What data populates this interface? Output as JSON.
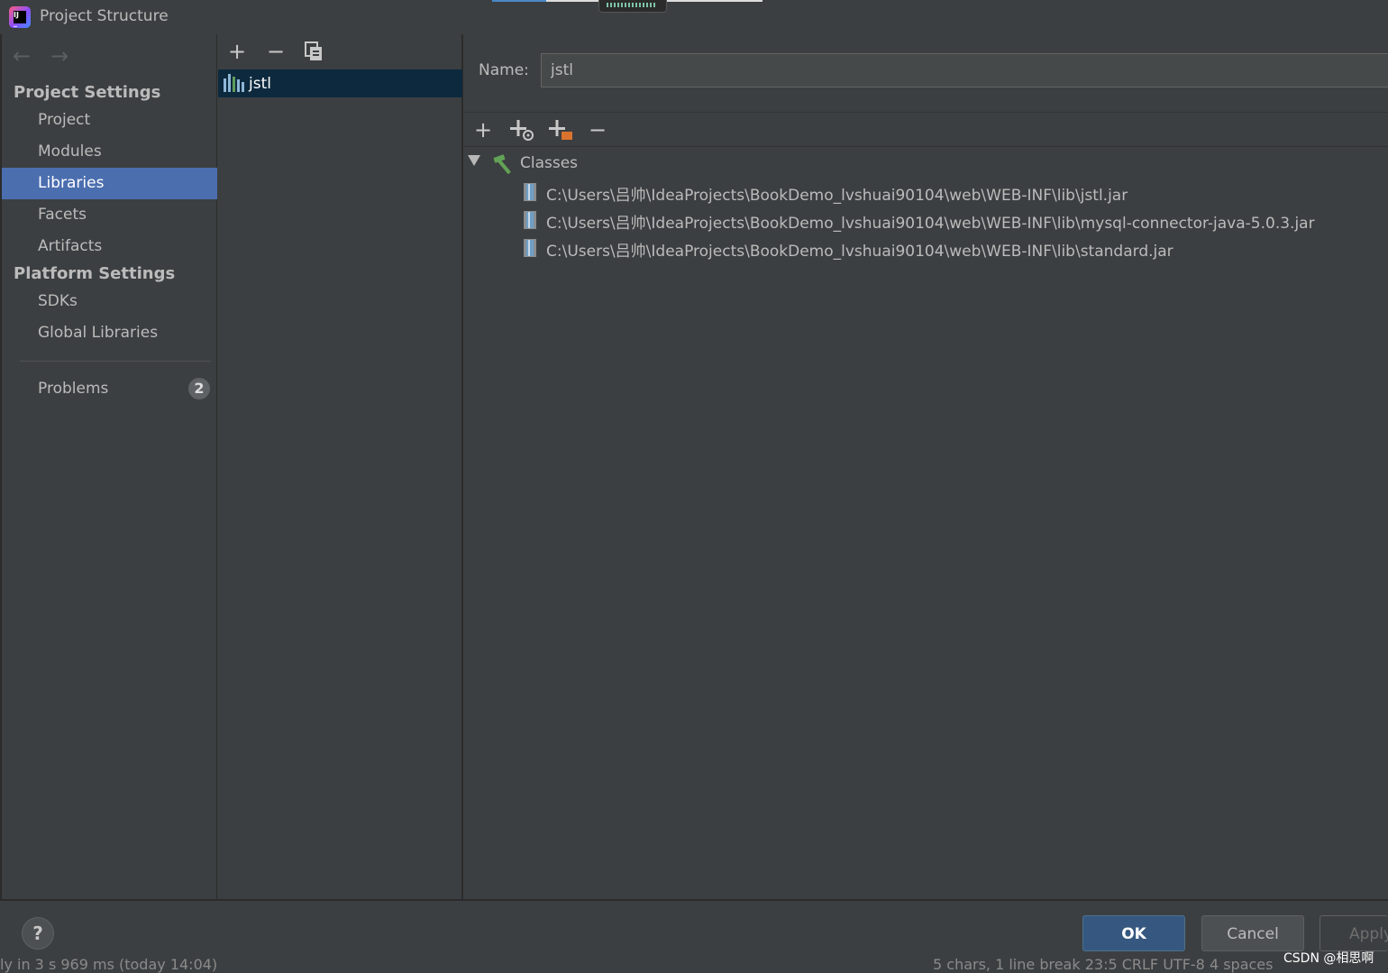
{
  "window": {
    "title": "Project Structure"
  },
  "nav": {
    "back_icon": "arrow-left-icon",
    "forward_icon": "arrow-right-icon",
    "project_settings_heading": "Project Settings",
    "project_items": [
      "Project",
      "Modules",
      "Libraries",
      "Facets",
      "Artifacts"
    ],
    "platform_settings_heading": "Platform Settings",
    "platform_items": [
      "SDKs",
      "Global Libraries"
    ],
    "problems_label": "Problems",
    "problems_count": "2",
    "selected": "Libraries"
  },
  "library_list": {
    "toolbar": {
      "add": "+",
      "remove": "−",
      "copy_icon": "copy-icon"
    },
    "items": [
      "jstl"
    ],
    "selected": "jstl"
  },
  "detail": {
    "name_label": "Name:",
    "name_value": "jstl",
    "toolbar": {
      "add": "+",
      "add_plugin_icon": "add-jar-icon",
      "add_dir_icon": "add-dir-icon",
      "remove": "−"
    },
    "classes_label": "Classes",
    "jar_paths": [
      "C:\\Users\\吕帅\\IdeaProjects\\BookDemo_lvshuai90104\\web\\WEB-INF\\lib\\jstl.jar",
      "C:\\Users\\吕帅\\IdeaProjects\\BookDemo_lvshuai90104\\web\\WEB-INF\\lib\\mysql-connector-java-5.0.3.jar",
      "C:\\Users\\吕帅\\IdeaProjects\\BookDemo_lvshuai90104\\web\\WEB-INF\\lib\\standard.jar"
    ]
  },
  "buttons": {
    "help": "?",
    "ok": "OK",
    "cancel": "Cancel",
    "apply": "Apply"
  },
  "statusbar": {
    "left": "ly in 3 s 969 ms (today 14:04)",
    "right": "5 chars, 1 line break    23:5    CRLF    UTF-8    4 spaces"
  },
  "watermark": "CSDN @相思啊",
  "colors": {
    "background": "#3c3f41",
    "selection": "#4b6eaf",
    "list_selection": "#0d293e",
    "ok_button": "#365880",
    "text": "#bbbbbb"
  }
}
